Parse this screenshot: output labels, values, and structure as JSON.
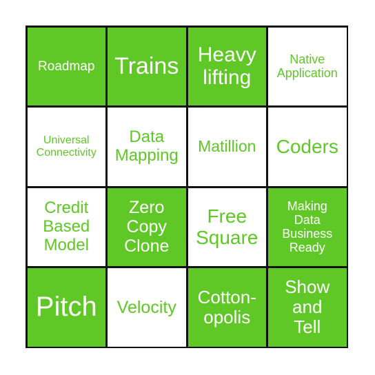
{
  "colors": {
    "marked_bg": "#5fc726",
    "unmarked_text": "#5fc726",
    "border": "#111111"
  },
  "cells": [
    {
      "text": "Roadmap",
      "marked": true,
      "size": 19
    },
    {
      "text": "Trains",
      "marked": true,
      "size": 34
    },
    {
      "text": "Heavy lifting",
      "marked": true,
      "size": 30
    },
    {
      "text": "Native Application",
      "marked": false,
      "size": 18
    },
    {
      "text": "Universal Connectivity",
      "marked": false,
      "size": 16
    },
    {
      "text": "Data Mapping",
      "marked": false,
      "size": 24
    },
    {
      "text": "Matillion",
      "marked": false,
      "size": 23
    },
    {
      "text": "Coders",
      "marked": false,
      "size": 28
    },
    {
      "text": "Credit Based Model",
      "marked": false,
      "size": 24
    },
    {
      "text": "Zero Copy Clone",
      "marked": true,
      "size": 25
    },
    {
      "text": "Free Square",
      "marked": false,
      "size": 28
    },
    {
      "text": "Making Data Business Ready",
      "marked": true,
      "size": 18
    },
    {
      "text": "Pitch",
      "marked": true,
      "size": 40
    },
    {
      "text": "Velocity",
      "marked": false,
      "size": 25
    },
    {
      "text": "Cotton-opolis",
      "marked": true,
      "size": 26
    },
    {
      "text": "Show and Tell",
      "marked": true,
      "size": 26
    }
  ]
}
